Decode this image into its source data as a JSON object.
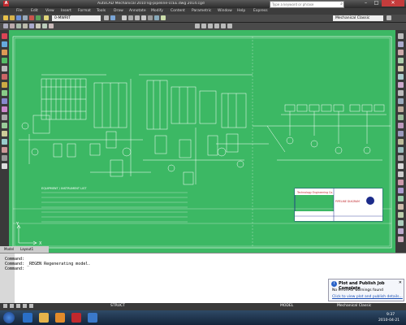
{
  "window": {
    "title": "AutoCAD Mechanical 2010   kg-pipeline-ccEE.dwg   2014.cgd",
    "search_placeholder": "Type a keyword or phrase"
  },
  "menu": [
    "File",
    "Edit",
    "View",
    "Insert",
    "Format",
    "Tools",
    "Draw",
    "Annotate",
    "Modify",
    "Content",
    "Parametric",
    "Window",
    "Help",
    "Express"
  ],
  "toolbar": {
    "layer_value": "0-MWRIT",
    "workspace_value": "Mechanical Classic"
  },
  "drawing": {
    "title_block_company": "Technology Engineering Co.",
    "title_block_project": "PIPELINE DIAGRAM",
    "legend_title": "EQUIPMENT / INSTRUMENT LIST"
  },
  "command": {
    "lines": [
      "Command:",
      "Command: _REGEN Regenerating model.",
      "Command:"
    ]
  },
  "tabs": [
    "Model",
    "Layout1"
  ],
  "status": {
    "model_label": "MODEL",
    "workspace": "Mechanical Classic",
    "struct_label": "STRUCT"
  },
  "notification": {
    "title": "Plot and Publish Job Complete",
    "line1": "No errors or warnings found",
    "link": "Click to view plot and publish details..."
  },
  "clock": {
    "time": "9:37",
    "date": "2010-04-21"
  },
  "colors": {
    "canvas": "#3cb864",
    "accent": "#c0282d"
  }
}
